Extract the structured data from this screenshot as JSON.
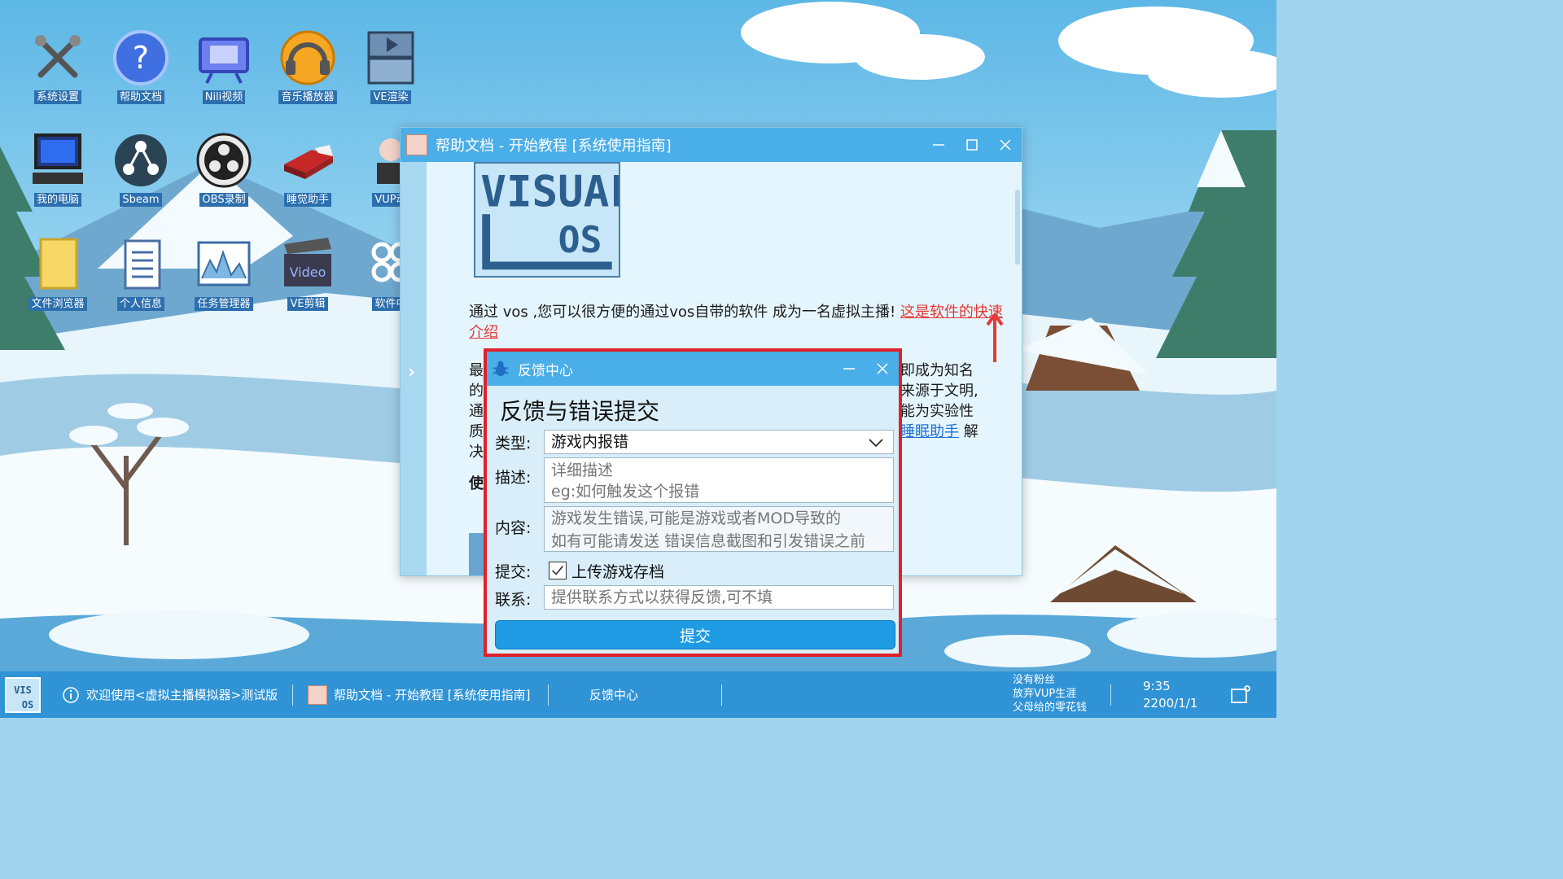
{
  "desktop": {
    "icons": [
      {
        "label": "系统设置",
        "icon": "settings-tools-icon"
      },
      {
        "label": "帮助文档",
        "icon": "help-question-icon"
      },
      {
        "label": "Nili视频",
        "icon": "video-tv-icon"
      },
      {
        "label": "音乐播放器",
        "icon": "music-headphones-icon"
      },
      {
        "label": "VE渲染",
        "icon": "render-encoder-icon"
      },
      {
        "label": "我的电脑",
        "icon": "computer-icon"
      },
      {
        "label": "Sbeam",
        "icon": "share-icon"
      },
      {
        "label": "OBS录制",
        "icon": "obs-record-icon"
      },
      {
        "label": "睡觉助手",
        "icon": "bed-icon"
      },
      {
        "label": "VUP动",
        "icon": "vup-avatar-icon"
      },
      {
        "label": "文件浏览器",
        "icon": "folder-icon"
      },
      {
        "label": "个人信息",
        "icon": "profile-card-icon"
      },
      {
        "label": "任务管理器",
        "icon": "task-chart-icon"
      },
      {
        "label": "VE剪辑",
        "icon": "video-clapper-icon"
      },
      {
        "label": "软件中",
        "icon": "software-center-icon"
      }
    ]
  },
  "help_window": {
    "title": "帮助文档 - 开始教程 [系统使用指南]",
    "intro_text": "通过 vos ,您可以很方便的通过vos自带的软件 成为一名虚拟主播! ",
    "intro_link": "这是软件的快速介绍",
    "p2_left": [
      "最",
      "的",
      "通",
      "质",
      "决"
    ],
    "p2_right": [
      "即成为知名",
      "来源于文明,",
      "能为实验性"
    ],
    "p2_link": "睡眠助手",
    "p2_after_link": " 解",
    "p3_left": "使"
  },
  "feedback_window": {
    "title": "反馈中心",
    "heading": "反馈与错误提交",
    "type_label": "类型:",
    "type_value": "游戏内报错",
    "desc_label": "描述:",
    "desc_placeholder_line1": "详细描述",
    "desc_placeholder_line2": "eg:如何触发这个报错",
    "content_label": "内容:",
    "content_placeholder_line1": "游戏发生错误,可能是游戏或者MOD导致的",
    "content_placeholder_line2": "如有可能请发送 错误信息截图和引发错误之前",
    "submit_label": "提交:",
    "upload_save_label": "上传游戏存档",
    "upload_save_checked": true,
    "contact_label": "联系:",
    "contact_placeholder": "提供联系方式以获得反馈,可不填",
    "submit_button": "提交"
  },
  "taskbar": {
    "welcome": "欢迎使用<虚拟主播模拟器>测试版",
    "task_help": "帮助文档 - 开始教程 [系统使用指南]",
    "task_feedback": "反馈中心",
    "status_line1": "没有粉丝",
    "status_line2": "放弃VUP生涯",
    "status_line3": "父母给的零花钱",
    "time": "9:35",
    "date": "2200/1/1"
  },
  "colors": {
    "titlebar": "#4aaee8",
    "taskbar": "#2f93d6",
    "highlight_border": "#e0202a",
    "submit_button": "#1e9be3"
  }
}
